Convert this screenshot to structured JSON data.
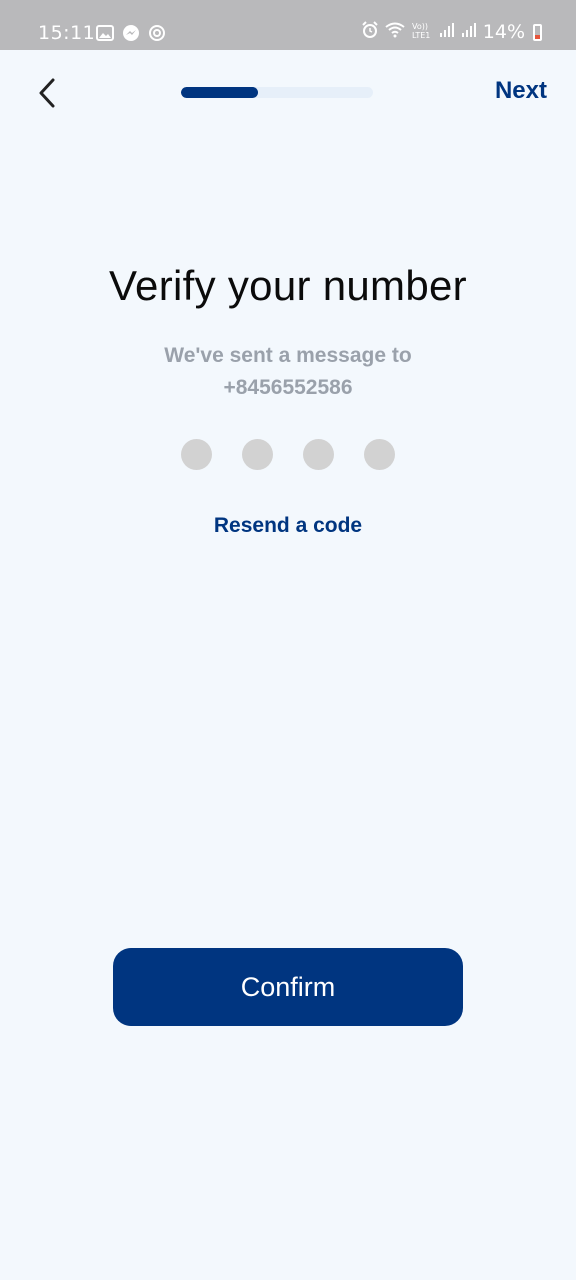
{
  "status_bar": {
    "time": "15:11",
    "battery": "14%",
    "left_icons": [
      "gallery-icon",
      "messenger-icon",
      "sync-icon"
    ],
    "right_icons": [
      "alarm-icon",
      "wifi-icon",
      "volte-icon",
      "signal-icon",
      "signal-icon"
    ]
  },
  "nav": {
    "back_icon": "chevron-left-icon",
    "next_label": "Next",
    "progress": 0.4
  },
  "main": {
    "title": "Verify your number",
    "subtitle_line1": "We've sent a message to",
    "subtitle_line2": "+8456552586",
    "code_length": 4,
    "resend_label": "Resend a code"
  },
  "footer": {
    "confirm_label": "Confirm"
  },
  "colors": {
    "accent": "#003580",
    "background": "#f3f8fd",
    "status_bar": "#b9b9bb",
    "code_dot": "#d2d2d2",
    "subtitle": "#9aa1ab"
  }
}
